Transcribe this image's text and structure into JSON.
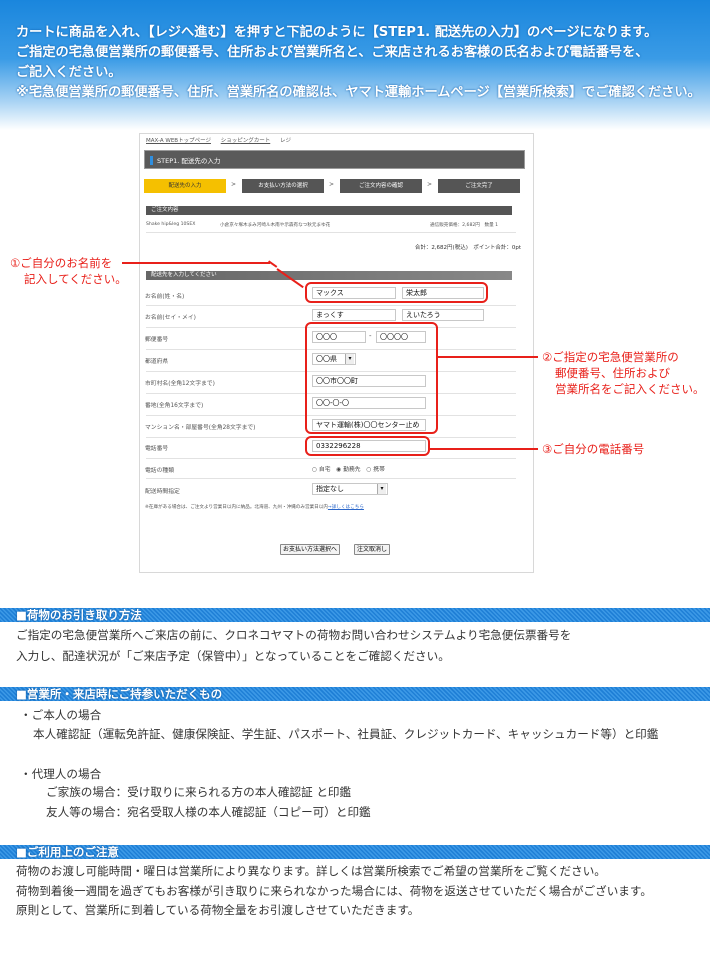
{
  "hero": {
    "line1": "カートに商品を入れ、【レジへ進む】を押すと下記のように【STEP1. 配送先の入力】のページになります。",
    "line2": "ご指定の宅急便営業所の郵便番号、住所および営業所名と、ご来店されるお客様の氏名および電話番号を、",
    "line3": "ご記入ください。",
    "line4": "※宅急便営業所の郵便番号、住所、営業所名の確認は、ヤマト運輸ホームページ【営業所検索】でご確認ください。"
  },
  "screenshot": {
    "breadcrumb": [
      "MAX-A WEBトップページ",
      "ショッピングカート",
      "レジ"
    ],
    "step_title": "STEP1. 配送先の入力",
    "steps": [
      "配送先の入力",
      "お支払い方法の選択",
      "ご注文内容の確認",
      "ご注文完了"
    ],
    "order_head": "ご注文内容",
    "order_item": "Shake hip&leg 10SEX",
    "order_desc": "小倉京々塚木まみ河崎ル木南や示森有なつ秋元まゆ花",
    "order_price": "通信販売価格：2,682円　数量 1",
    "order_total": "合計：2,682円(税込)　ポイント合計：0pt",
    "form_head": "配送先を入力してください",
    "labels": {
      "name": "お名前(姓・名)",
      "kana": "お名前(セイ・メイ)",
      "zip": "郵便番号",
      "pref": "都道府県",
      "city": "市町村名(全角12文字まで)",
      "street": "番地(全角16文字まで)",
      "building": "マンション名・部屋番号(全角28文字まで)",
      "phone": "電話番号",
      "phone_type": "電話の種類",
      "time": "配送時間指定"
    },
    "values": {
      "last_name": "マックス",
      "first_name": "栄太郎",
      "last_kana": "まっくす",
      "first_kana": "えいたろう",
      "zip1": "〇〇〇",
      "zip_sep": "-",
      "zip2": "〇〇〇〇",
      "pref": "〇〇県",
      "city": "〇〇市〇〇町",
      "street": "〇〇-〇-〇",
      "building": "ヤマト運輸(株)〇〇センター止め",
      "phone": "0332296228",
      "time": "指定なし"
    },
    "phone_types": "○ 自宅　◉ 勤務先　○ 携帯",
    "note_text": "※在庫がある場合は、ご注文より営業日以内に納品。北海道、九州・沖縄のみ営業日以内",
    "note_link": "→詳しくはこちら",
    "btn_next": "お支払い方法選択へ",
    "btn_cancel": "注文取消し"
  },
  "annotations": {
    "a1_line1": "①ご自分のお名前を",
    "a1_line2": "記入してください。",
    "a2_line1": "②ご指定の宅急便営業所の",
    "a2_line2": "郵便番号、住所および",
    "a2_line3": "営業所名をご記入ください。",
    "a3": "③ご自分の電話番号"
  },
  "section1": {
    "heading": "■荷物のお引き取り方法",
    "line1": "ご指定の宅急便営業所へご来店の前に、クロネコヤマトの荷物お問い合わせシステムより宅急便伝票番号を",
    "line2": "入力し、配達状況が「ご来店予定（保管中）」となっていることをご確認ください。"
  },
  "section2": {
    "heading": "■営業所・来店時にご持参いただくもの",
    "line1": "・ご本人の場合",
    "line2": "本人確認証（運転免許証、健康保険証、学生証、パスポート、社員証、クレジットカード、キャッシュカード等）と印鑑",
    "line3": "・代理人の場合",
    "line4": "ご家族の場合：受け取りに来られる方の本人確認証 と印鑑",
    "line5": "友人等の場合：宛名受取人様の本人確認証（コピー可）と印鑑"
  },
  "section3": {
    "heading": "■ご利用上のご注意",
    "line1": "荷物のお渡し可能時間・曜日は営業所により異なります。詳しくは営業所検索でご希望の営業所をご覧ください。",
    "line2": "荷物到着後一週間を過ぎてもお客様が引き取りに来られなかった場合には、荷物を返送させていただく場合がございます。",
    "line3": "原則として、営業所に到着している荷物全量をお引渡しさせていただきます。"
  },
  "colors": {
    "accent_blue": "#1f7fd6",
    "annotation_red": "#e8201a",
    "step_active": "#f5c000"
  }
}
